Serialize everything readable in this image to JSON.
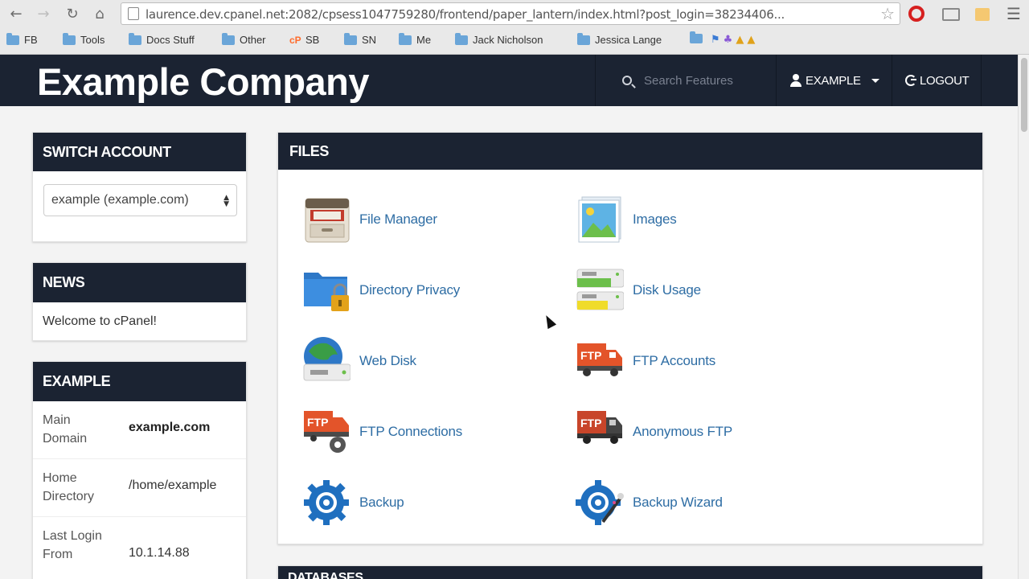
{
  "browser": {
    "url": "laurence.dev.cpanel.net:2082/cpsess1047759280/frontend/paper_lantern/index.html?post_login=38234406...",
    "bookmarks": [
      "FB",
      "Tools",
      "Docs Stuff",
      "Other",
      "SB",
      "SN",
      "Me",
      "Jack Nicholson",
      "Jessica Lange"
    ]
  },
  "header": {
    "company_name": "Example Company",
    "search_placeholder": "Search Features",
    "user_label": "EXAMPLE",
    "logout_label": "LOGOUT"
  },
  "switch_account": {
    "title": "SWITCH ACCOUNT",
    "selected": "example (example.com)"
  },
  "news": {
    "title": "NEWS",
    "message": "Welcome to cPanel!"
  },
  "stats": {
    "title": "EXAMPLE",
    "rows": [
      {
        "label": "Main Domain",
        "value": "example.com"
      },
      {
        "label": "Home Directory",
        "value": "/home/example"
      },
      {
        "label": "Last Login From",
        "value": "10.1.14.88"
      }
    ]
  },
  "files": {
    "title": "FILES",
    "items": [
      {
        "label": "File Manager",
        "icon": "file-manager-icon"
      },
      {
        "label": "Images",
        "icon": "images-icon"
      },
      {
        "label": "Directory Privacy",
        "icon": "directory-privacy-icon"
      },
      {
        "label": "Disk Usage",
        "icon": "disk-usage-icon"
      },
      {
        "label": "Web Disk",
        "icon": "web-disk-icon"
      },
      {
        "label": "FTP Accounts",
        "icon": "ftp-accounts-icon"
      },
      {
        "label": "FTP Connections",
        "icon": "ftp-connections-icon"
      },
      {
        "label": "Anonymous FTP",
        "icon": "anonymous-ftp-icon"
      },
      {
        "label": "Backup",
        "icon": "backup-icon"
      },
      {
        "label": "Backup Wizard",
        "icon": "backup-wizard-icon"
      }
    ]
  },
  "ftp_badge": "FTP",
  "next_section": {
    "title": "DATABASES"
  },
  "colors": {
    "header_bg": "#1b2332",
    "link": "#2e6da4",
    "page_bg": "#f3f3f3"
  }
}
